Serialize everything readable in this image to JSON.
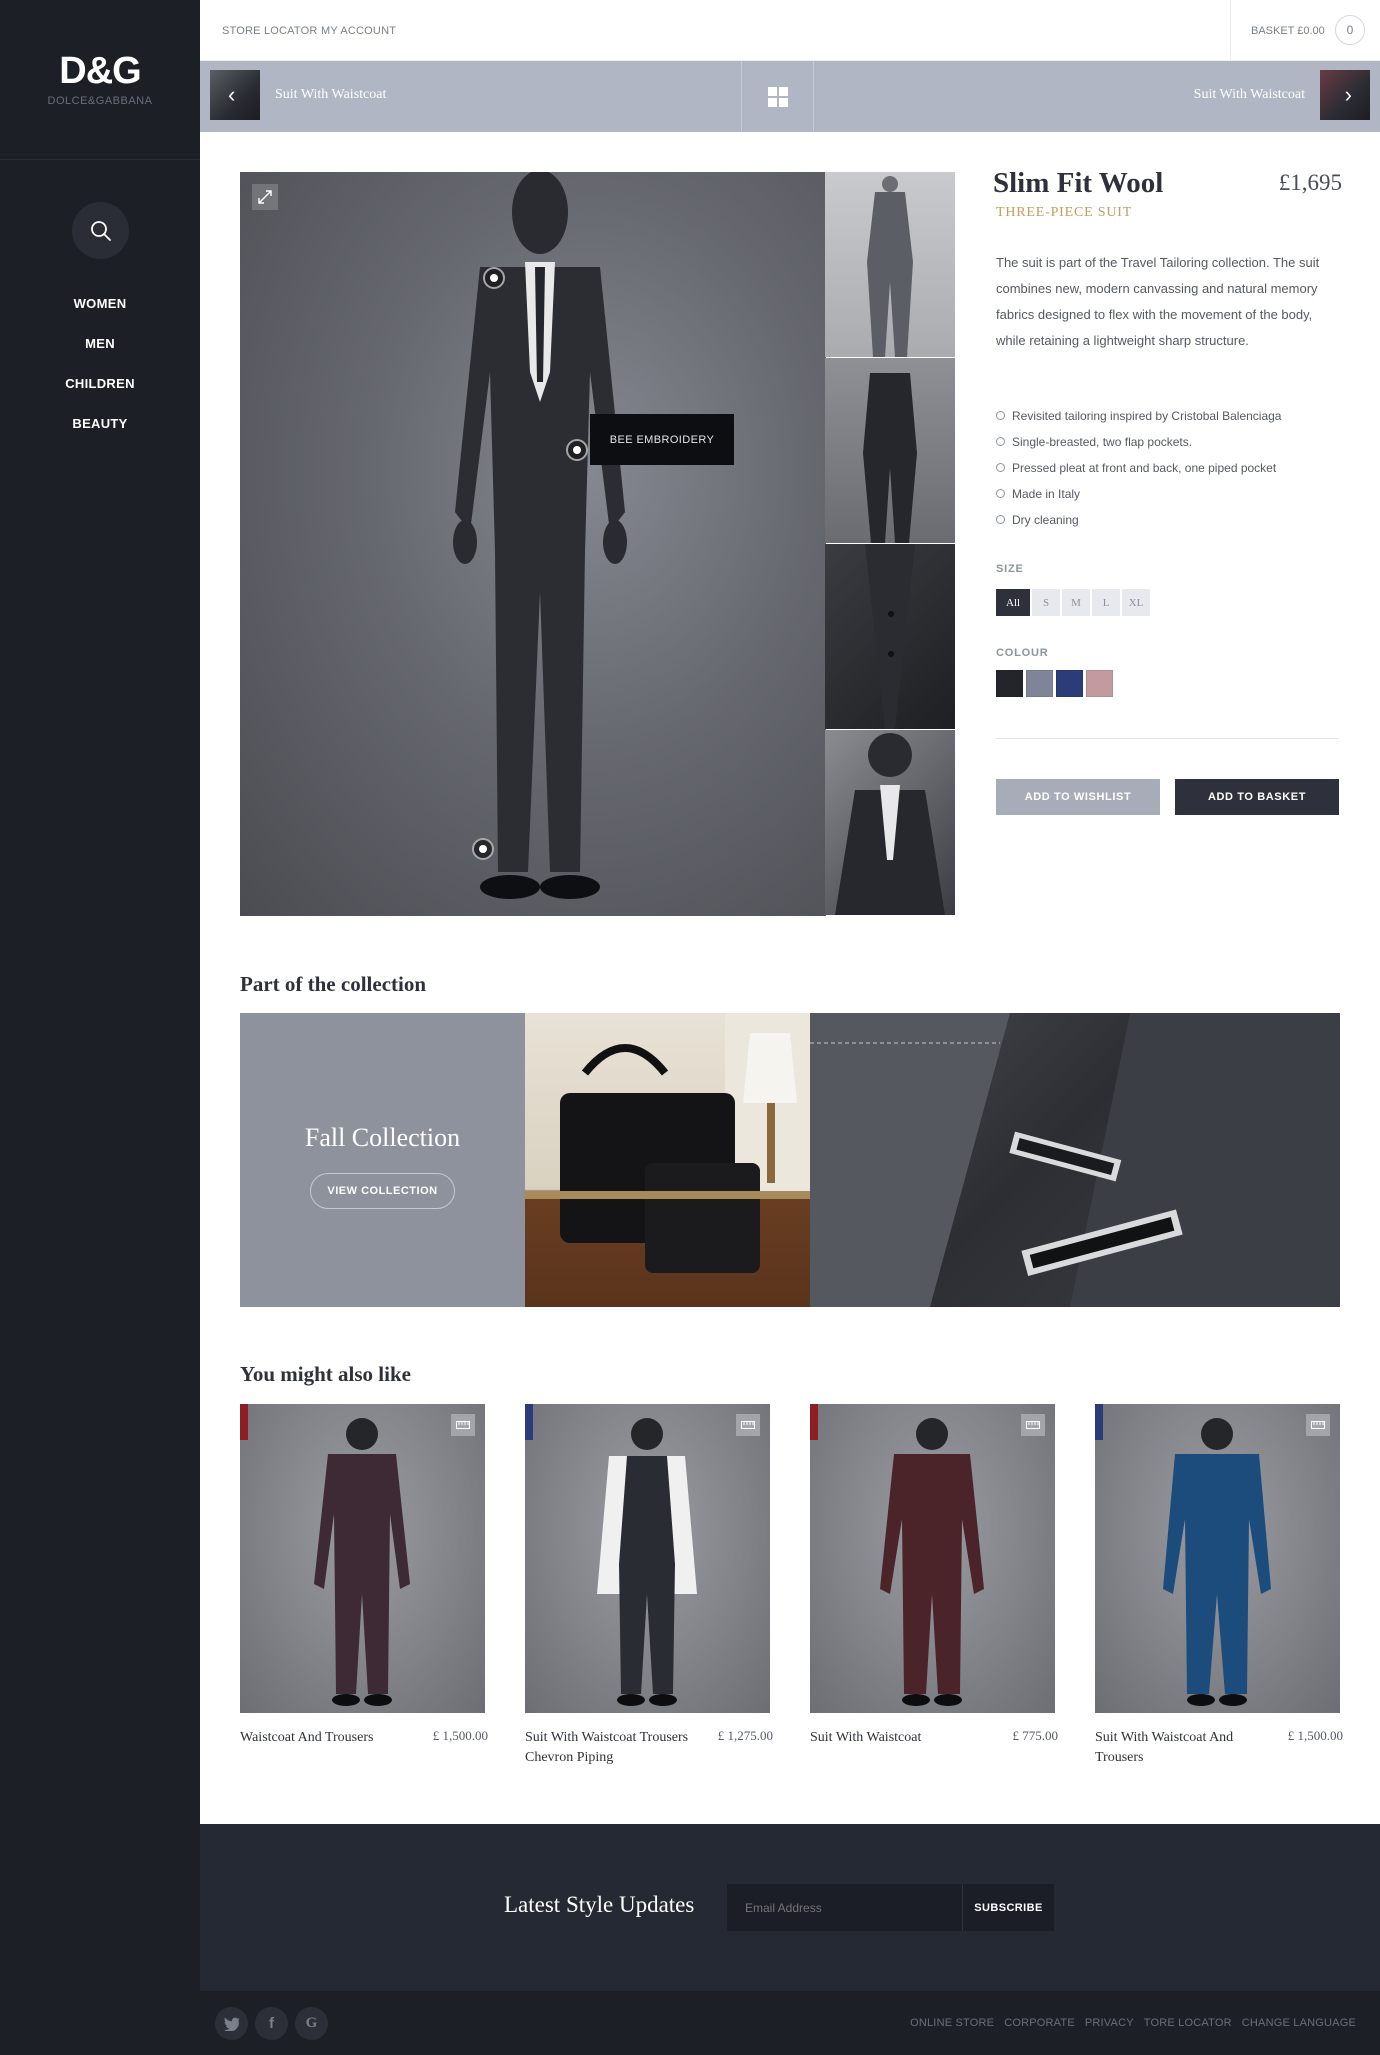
{
  "sidebar": {
    "logo": "D&G",
    "logo_sub": "DOLCE&GABBANA",
    "nav": [
      "WOMEN",
      "MEN",
      "CHILDREN",
      "BEAUTY"
    ]
  },
  "topbar": {
    "store_locator": "STORE LOCATOR",
    "my_account": "MY ACCOUNT",
    "basket": "BASKET £0.00",
    "basket_count": "0"
  },
  "prodnav": {
    "prev_label": "Suit With Waistcoat",
    "next_label": "Suit With Waistcoat"
  },
  "product": {
    "title": "Slim Fit Wool",
    "subtitle": "THREE-PIECE SUIT",
    "price": "£1,695",
    "description": "The suit is part of the Travel Tailoring collection. The suit combines new, modern canvassing and natural memory fabrics designed to flex with the movement of the body, while retaining a lightweight sharp structure.",
    "features": [
      "Revisited tailoring inspired by Cristobal Balenciaga",
      "Single-breasted, two flap pockets.",
      "Pressed pleat at front and back, one piped pocket",
      "Made in Italy",
      "Dry cleaning"
    ],
    "hotspot_tooltip": "BEE EMBROIDERY",
    "size_label": "SIZE",
    "sizes": [
      "All",
      "S",
      "M",
      "L",
      "XL"
    ],
    "selected_size": "All",
    "colour_label": "COLOUR",
    "colours": [
      "#23252b",
      "#7f8596",
      "#2c3c78",
      "#c39aa0"
    ],
    "wishlist_label": "ADD TO WISHLIST",
    "basket_label": "ADD TO BASKET"
  },
  "collection": {
    "heading": "Part of the collection",
    "card_title": "Fall Collection",
    "card_button": "VIEW COLLECTION"
  },
  "recommendations": {
    "heading": "You might also like",
    "items": [
      {
        "name": "Waistcoat And Trousers",
        "price": "£ 1,500.00",
        "flag": "#8d1f24",
        "suit": "#3e2a35"
      },
      {
        "name": "Suit With Waistcoat Trousers Chevron Piping",
        "price": "£ 1,275.00",
        "flag": "#2c3c78",
        "suit": "#2a2c33"
      },
      {
        "name": "Suit With Waistcoat",
        "price": "£ 775.00",
        "flag": "#8d1f24",
        "suit": "#4a2428"
      },
      {
        "name": "Suit With Waistcoat And Trousers",
        "price": "£ 1,500.00",
        "flag": "#2c3c78",
        "suit": "#1c4c7c"
      }
    ]
  },
  "newsletter": {
    "title": "Latest Style Updates",
    "placeholder": "Email Address",
    "button": "SUBSCRIBE"
  },
  "footer": {
    "social": [
      "twitter-icon",
      "facebook-icon",
      "google-icon"
    ],
    "links": [
      "ONLINE STORE",
      "CORPORATE",
      "PRIVACY",
      "TORE LOCATOR",
      "CHANGE LANGUAGE"
    ]
  }
}
